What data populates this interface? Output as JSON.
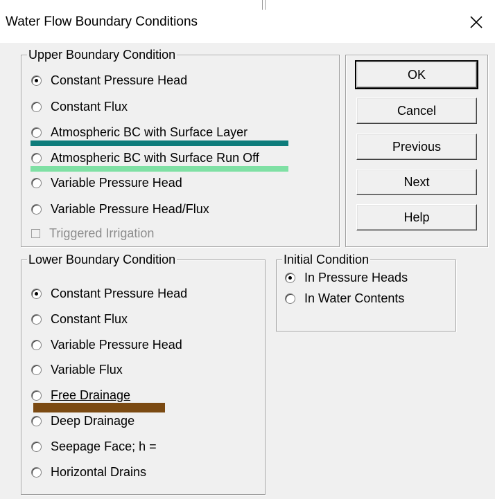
{
  "window": {
    "title": "Water Flow Boundary Conditions",
    "close_glyph": "✕"
  },
  "upper": {
    "legend": "Upper Boundary Condition",
    "options": [
      {
        "label": "Constant Pressure Head",
        "selected": true
      },
      {
        "label": "Constant Flux",
        "selected": false
      },
      {
        "label": "Atmospheric BC with Surface Layer",
        "selected": false
      },
      {
        "label": "Atmospheric BC with Surface Run Off",
        "selected": false
      },
      {
        "label": "Variable Pressure Head",
        "selected": false
      },
      {
        "label": "Variable Pressure Head/Flux",
        "selected": false
      }
    ],
    "checkbox": {
      "label": "Triggered Irrigation",
      "checked": false,
      "disabled": true
    }
  },
  "buttons": {
    "ok": "OK",
    "cancel": "Cancel",
    "previous": "Previous",
    "next": "Next",
    "help": "Help"
  },
  "lower": {
    "legend": "Lower Boundary Condition",
    "options": [
      {
        "label": "Constant Pressure Head",
        "selected": true
      },
      {
        "label": "Constant Flux",
        "selected": false
      },
      {
        "label": "Variable Pressure Head",
        "selected": false
      },
      {
        "label": "Variable Flux",
        "selected": false
      },
      {
        "label": "Free Drainage",
        "selected": false
      },
      {
        "label": "Deep Drainage",
        "selected": false
      },
      {
        "label": "Seepage Face; h =",
        "selected": false
      },
      {
        "label": "Horizontal Drains",
        "selected": false
      }
    ]
  },
  "initial": {
    "legend": "Initial Condition",
    "options": [
      {
        "label": "In Pressure Heads",
        "selected": true
      },
      {
        "label": "In Water Contents",
        "selected": false
      }
    ]
  },
  "highlights": {
    "teal": "#0e7c7b",
    "mint": "#7fe0a4",
    "brown": "#7b4a12"
  }
}
